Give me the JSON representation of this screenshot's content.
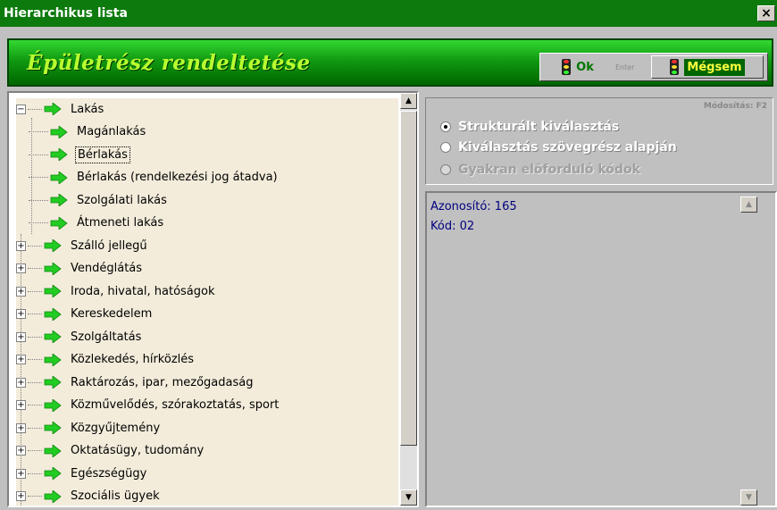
{
  "window": {
    "title": "Hierarchikus lista",
    "close_label": "×"
  },
  "header": {
    "title": "Épületrész rendeltetése",
    "ok_label": "Ok",
    "enter_hint": "Enter",
    "cancel_label": "Mégsem"
  },
  "tree": {
    "items": [
      {
        "label": "Lakás",
        "expander": "−",
        "selected": false
      },
      {
        "label": "Magánlakás",
        "selected": false
      },
      {
        "label": "Bérlakás",
        "selected": true
      },
      {
        "label": "Bérlakás (rendelkezési jog átadva)",
        "selected": false
      },
      {
        "label": "Szolgálati lakás",
        "selected": false
      },
      {
        "label": "Átmeneti lakás",
        "selected": false
      },
      {
        "label": "Szálló jellegű",
        "expander": "+"
      },
      {
        "label": "Vendéglátás",
        "expander": "+"
      },
      {
        "label": "Iroda, hivatal, hatóságok",
        "expander": "+"
      },
      {
        "label": "Kereskedelem",
        "expander": "+"
      },
      {
        "label": "Szolgáltatás",
        "expander": "+"
      },
      {
        "label": "Közlekedés, hírközlés",
        "expander": "+"
      },
      {
        "label": "Raktározás, ipar, mezőgadaság",
        "expander": "+"
      },
      {
        "label": "Közművelődés, szórakoztatás, sport",
        "expander": "+"
      },
      {
        "label": "Közgyűjtemény",
        "expander": "+"
      },
      {
        "label": "Oktatásügy, tudomány",
        "expander": "+"
      },
      {
        "label": "Egészségügy",
        "expander": "+"
      },
      {
        "label": "Szociális ügyek",
        "expander": "+"
      }
    ],
    "scroll_up": "▲",
    "scroll_down": "▼"
  },
  "options": {
    "modify_hint": "Módosítás: F2",
    "radios": [
      {
        "label": "Strukturált kiválasztás",
        "checked": true,
        "enabled": true
      },
      {
        "label": "Kiválasztás szövegrész alapján",
        "checked": false,
        "enabled": true
      },
      {
        "label": "Gyakran előforduló kódok",
        "checked": false,
        "enabled": false
      }
    ]
  },
  "info": {
    "id_line": "Azonosító: 165",
    "code_line": "Kód: 02"
  },
  "colors": {
    "title_bar": "#0c7a0c",
    "banner_text": "#b8ff30",
    "tree_bg": "#f3ecdb",
    "arrow": "#22cc22"
  }
}
